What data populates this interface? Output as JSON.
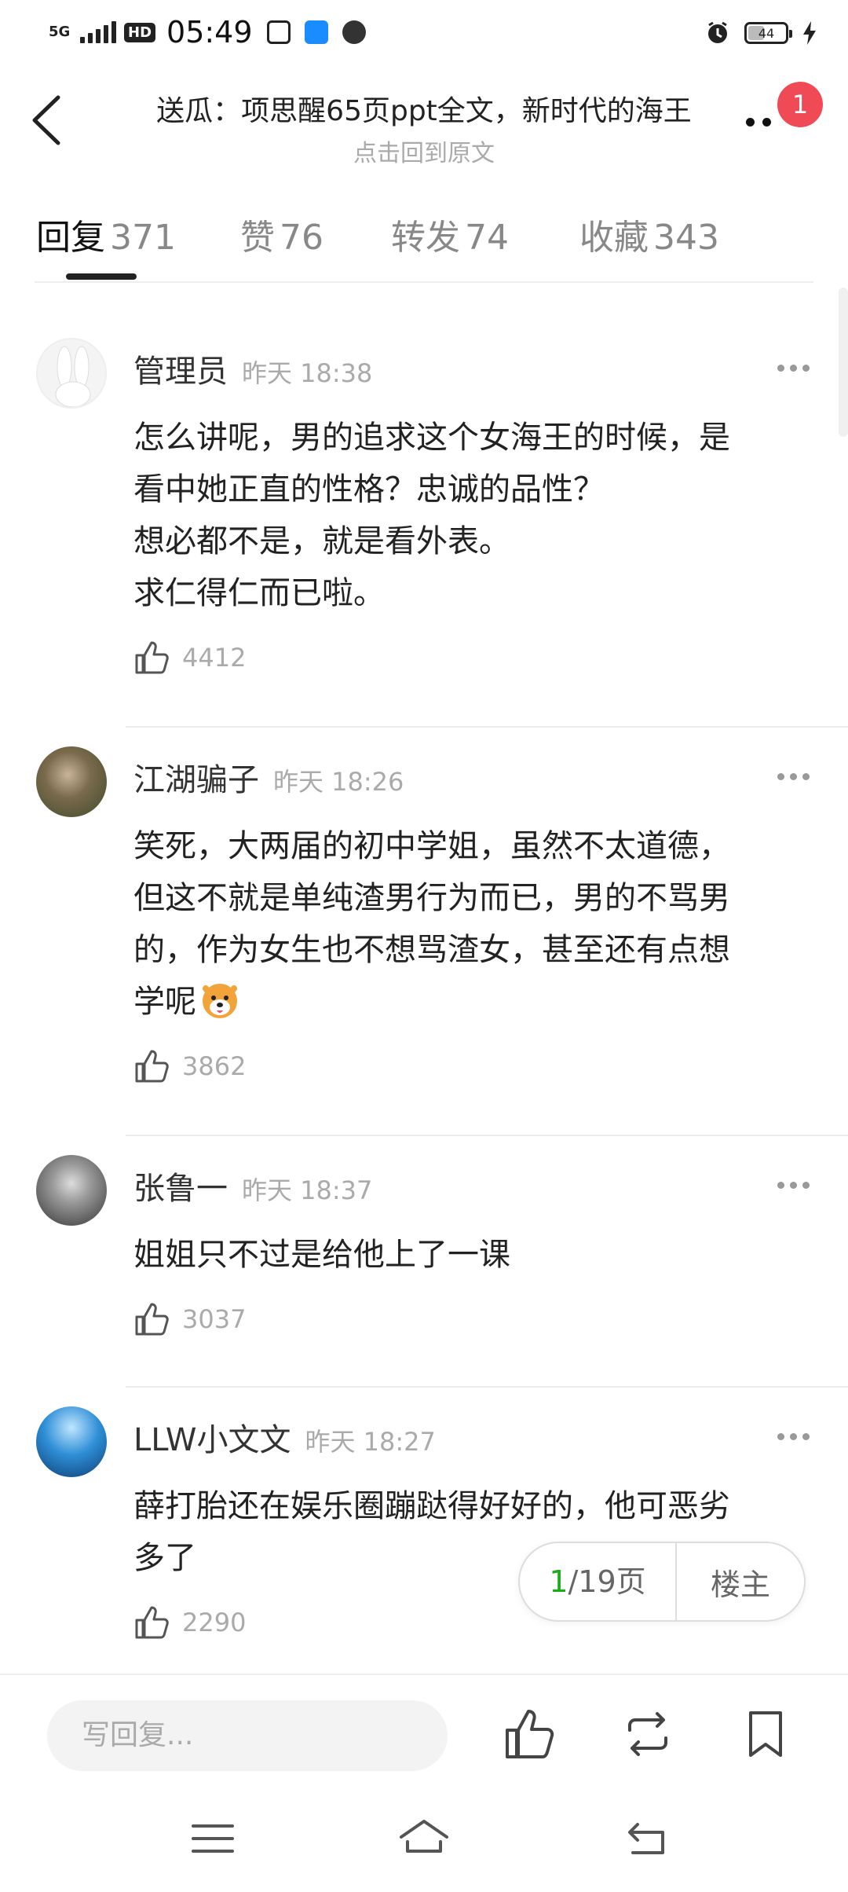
{
  "status_bar": {
    "network": "5G",
    "hd": "HD",
    "time": "05:49",
    "battery": "44",
    "battery_level": 0.44
  },
  "header": {
    "title": "送瓜：项思醒65页ppt全文，新时代的海王",
    "subtitle": "点击回到原文",
    "notification_count": "1"
  },
  "tabs": [
    {
      "label": "回复",
      "count": "371",
      "active": true
    },
    {
      "label": "赞",
      "count": "76",
      "active": false
    },
    {
      "label": "转发",
      "count": "74",
      "active": false
    },
    {
      "label": "收藏",
      "count": "343",
      "active": false
    }
  ],
  "comments": [
    {
      "name": "管理员",
      "time": "昨天 18:38",
      "lines": [
        "怎么讲呢，男的追求这个女海王的时候，是",
        "看中她正直的性格？忠诚的品性？",
        "想必都不是，就是看外表。",
        "求仁得仁而已啦。"
      ],
      "likes": "4412"
    },
    {
      "name": "江湖骗子",
      "time": "昨天 18:26",
      "lines": [
        "笑死，大两届的初中学姐，虽然不太道德，",
        "但这不就是单纯渣男行为而已，男的不骂男",
        "的，作为女生也不想骂渣女，甚至还有点想",
        "学呢"
      ],
      "likes": "3862"
    },
    {
      "name": "张鲁一",
      "time": "昨天 18:37",
      "lines": [
        "姐姐只不过是给他上了一课"
      ],
      "likes": "3037"
    },
    {
      "name": "LLW小文文",
      "time": "昨天 18:27",
      "lines": [
        "薛打胎还在娱乐圈蹦跶得好好的，他可恶劣",
        "多了"
      ],
      "likes": "2290"
    }
  ],
  "pager": {
    "current": "1",
    "total": "/19页",
    "op_label": "楼主"
  },
  "bottom_bar": {
    "reply_placeholder": "写回复..."
  }
}
